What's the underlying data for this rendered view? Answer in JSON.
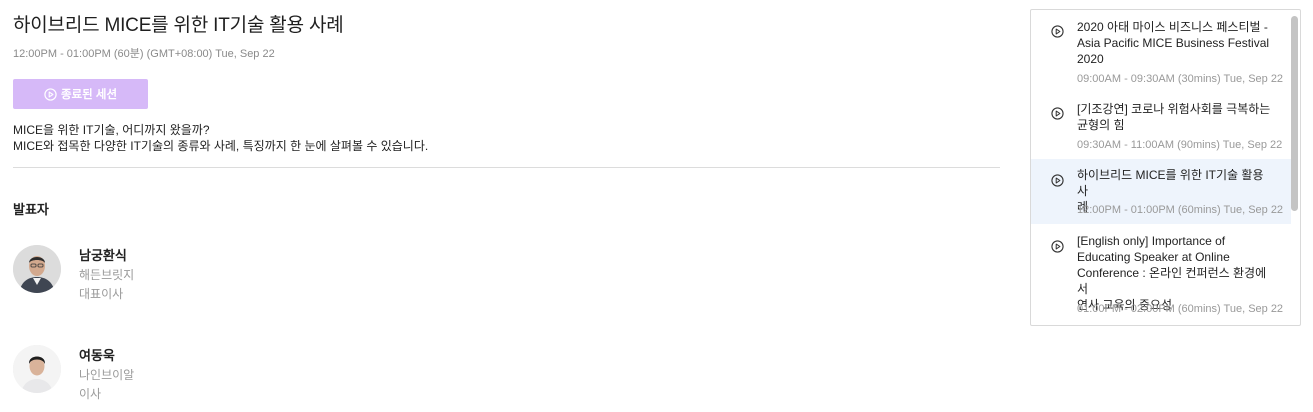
{
  "session": {
    "title": "하이브리드 MICE를 위한 IT기술 활용 사례",
    "time": "12:00PM - 01:00PM (60분) (GMT+08:00) Tue, Sep 22",
    "ended_button_label": "종료된 세션",
    "description": [
      "MICE을 위한 IT기술, 어디까지 왔을까?",
      "MICE와 접목한 다양한 IT기술의 종류와 사례, 특징까지 한 눈에 살펴볼 수 있습니다."
    ]
  },
  "speakers": {
    "heading": "발표자",
    "list": [
      {
        "name": "남궁환식",
        "org": "해든브릿지",
        "role": "대표이사"
      },
      {
        "name": "여동욱",
        "org": "나인브이알",
        "role": "이사"
      }
    ]
  },
  "sidebar": {
    "sessions": [
      {
        "title_lines": [
          "2020 아태 마이스 비즈니스 페스티벌 -",
          "Asia Pacific MICE Business Festival",
          "2020"
        ],
        "time": "09:00AM - 09:30AM (30mins) Tue, Sep 22",
        "active": false
      },
      {
        "title_lines": [
          "[기조강연] 코로나 위험사회를 극복하는",
          "균형의 힘"
        ],
        "time": "09:30AM - 11:00AM (90mins) Tue, Sep 22",
        "active": false
      },
      {
        "title_lines": [
          "하이브리드 MICE를 위한 IT기술 활용 사",
          "례"
        ],
        "time": "12:00PM - 01:00PM (60mins) Tue, Sep 22",
        "active": true
      },
      {
        "title_lines": [
          "[English only] Importance of",
          "Educating Speaker at Online",
          "Conference : 온라인 컨퍼런스 환경에서",
          "연사 교육의 중요성"
        ],
        "time": "01:00PM - 02:00PM (60mins) Tue, Sep 22",
        "active": false
      }
    ]
  },
  "colors": {
    "ended_button_bg": "#d6b9f8",
    "active_session_bg": "#eef4fc"
  }
}
